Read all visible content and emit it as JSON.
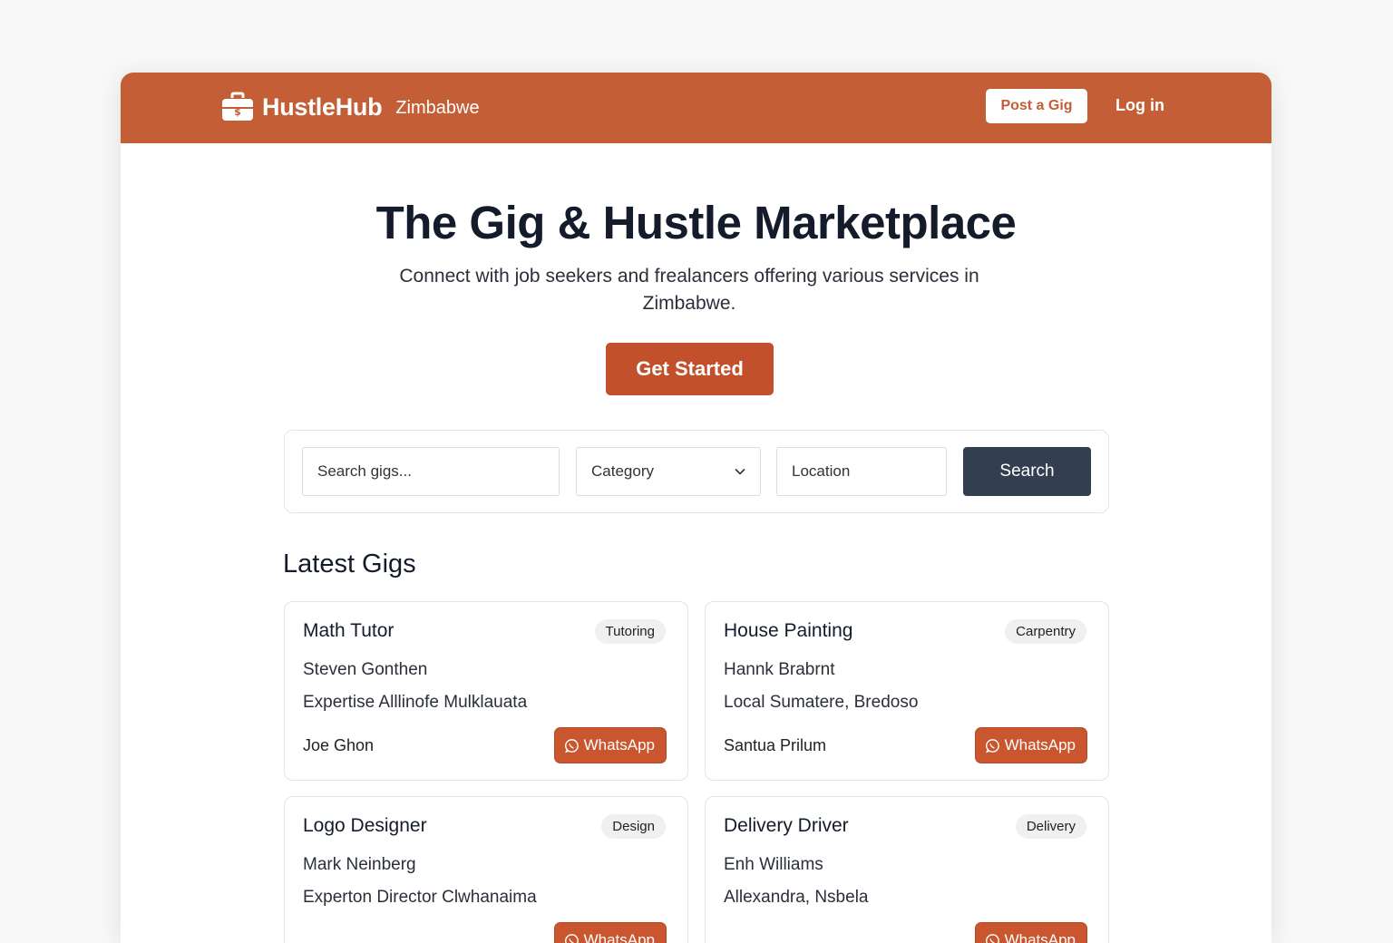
{
  "navbar": {
    "brand_name": "HustleHub",
    "brand_region": "Zimbabwe",
    "post_label": "Post a Gig",
    "login_label": "Log in",
    "brand_color": "#c45e36"
  },
  "hero": {
    "title": "The Gig & Hustle Marketplace",
    "subtitle": "Connect with job seekers and frealancers offering various services in Zimbabwe.",
    "cta_label": "Get Started"
  },
  "search": {
    "query_placeholder": "Search gigs...",
    "category_value": "Category",
    "location_placeholder": "Location",
    "button_label": "Search"
  },
  "latest": {
    "title": "Latest Gigs",
    "gigs": [
      {
        "title": "Math Tutor",
        "category": "Tutoring",
        "name": "Steven Gonthen",
        "detail": "Expertise Alllinofe Mulklauata",
        "contact": "Joe Ghon",
        "action": "WhatsApp"
      },
      {
        "title": "House Painting",
        "category": "Carpentry",
        "name": "Hannk Brabrnt",
        "detail": "Local Sumatere, Bredoso",
        "contact": "Santua Prilum",
        "action": "WhatsApp"
      },
      {
        "title": "Logo Designer",
        "category": "Design",
        "name": "Mark Neinberg",
        "detail": "Experton Director Clwhanaima",
        "contact": "",
        "action": "WhatsApp"
      },
      {
        "title": "Delivery Driver",
        "category": "Delivery",
        "name": "Enh Williams",
        "detail": "Allexandra, Nsbela",
        "contact": "",
        "action": "WhatsApp"
      }
    ]
  }
}
